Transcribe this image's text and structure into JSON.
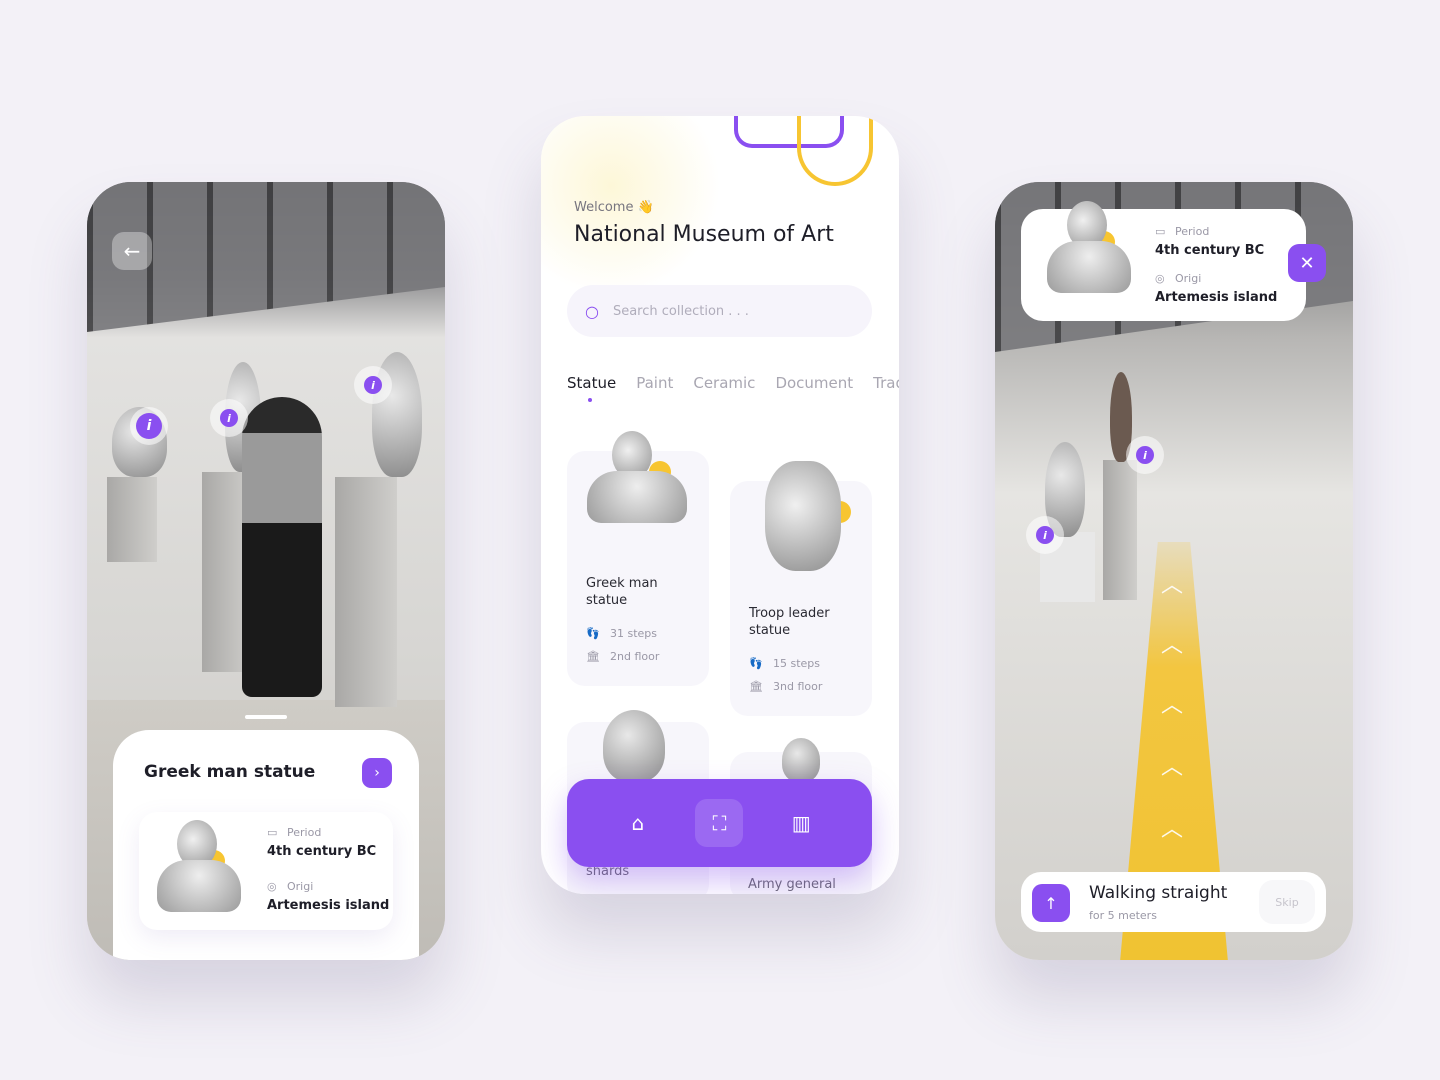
{
  "colors": {
    "accent": "#8a4ff0",
    "highlight": "#f7c531",
    "background": "#f3f1f7"
  },
  "screen_detail": {
    "back_icon": "arrow-left-icon",
    "sheet_title": "Greek man statue",
    "period_label": "Period",
    "period_value": "4th century BC",
    "origin_label": "Origi",
    "origin_value": "Artemesis island"
  },
  "screen_home": {
    "welcome": "Welcome 👋",
    "title": "National Museum of Art",
    "search_placeholder": "Search collection . . .",
    "tabs": [
      {
        "label": "Statue",
        "active": true
      },
      {
        "label": "Paint"
      },
      {
        "label": "Ceramic"
      },
      {
        "label": "Document"
      },
      {
        "label": "Tradit"
      }
    ],
    "cards": [
      {
        "name": "Greek man statue",
        "steps": "31 steps",
        "floor": "2nd floor"
      },
      {
        "name": "Troop leader statue",
        "steps": "15 steps",
        "floor": "3nd floor"
      },
      {
        "name": "shards"
      },
      {
        "name": "Army general"
      }
    ],
    "nav": [
      {
        "icon": "home-icon"
      },
      {
        "icon": "scan-icon",
        "active": true
      },
      {
        "icon": "map-icon"
      }
    ]
  },
  "screen_nav": {
    "period_label": "Period",
    "period_value": "4th century BC",
    "origin_label": "Origi",
    "origin_value": "Artemesis island",
    "instruction": "Walking straight",
    "instruction_sub": "for 5 meters",
    "skip": "Skip"
  }
}
